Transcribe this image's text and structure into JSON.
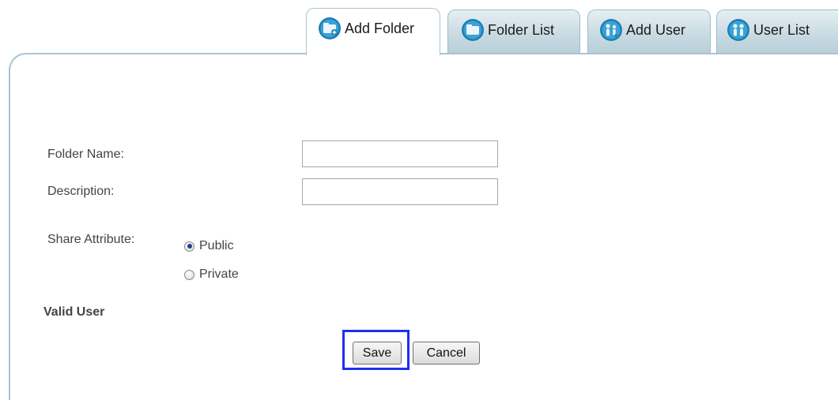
{
  "tabs": [
    {
      "label": "Add Folder",
      "icon": "folder-add-icon",
      "active": true
    },
    {
      "label": "Folder List",
      "icon": "folder-icon",
      "active": false
    },
    {
      "label": "Add User",
      "icon": "user-add-icon",
      "active": false
    },
    {
      "label": "User List",
      "icon": "users-icon",
      "active": false
    }
  ],
  "form": {
    "folder_name_label": "Folder Name:",
    "folder_name_value": "",
    "description_label": "Description:",
    "description_value": "",
    "share_attribute_label": "Share Attribute:",
    "share_options": [
      {
        "label": "Public",
        "checked": true
      },
      {
        "label": "Private",
        "checked": false
      }
    ],
    "valid_user_label": "Valid User"
  },
  "buttons": {
    "save_label": "Save",
    "cancel_label": "Cancel"
  },
  "colors": {
    "tab_border": "#a9c4d0",
    "icon_blue": "#1d7fb3",
    "highlight": "#1f2ff0"
  }
}
